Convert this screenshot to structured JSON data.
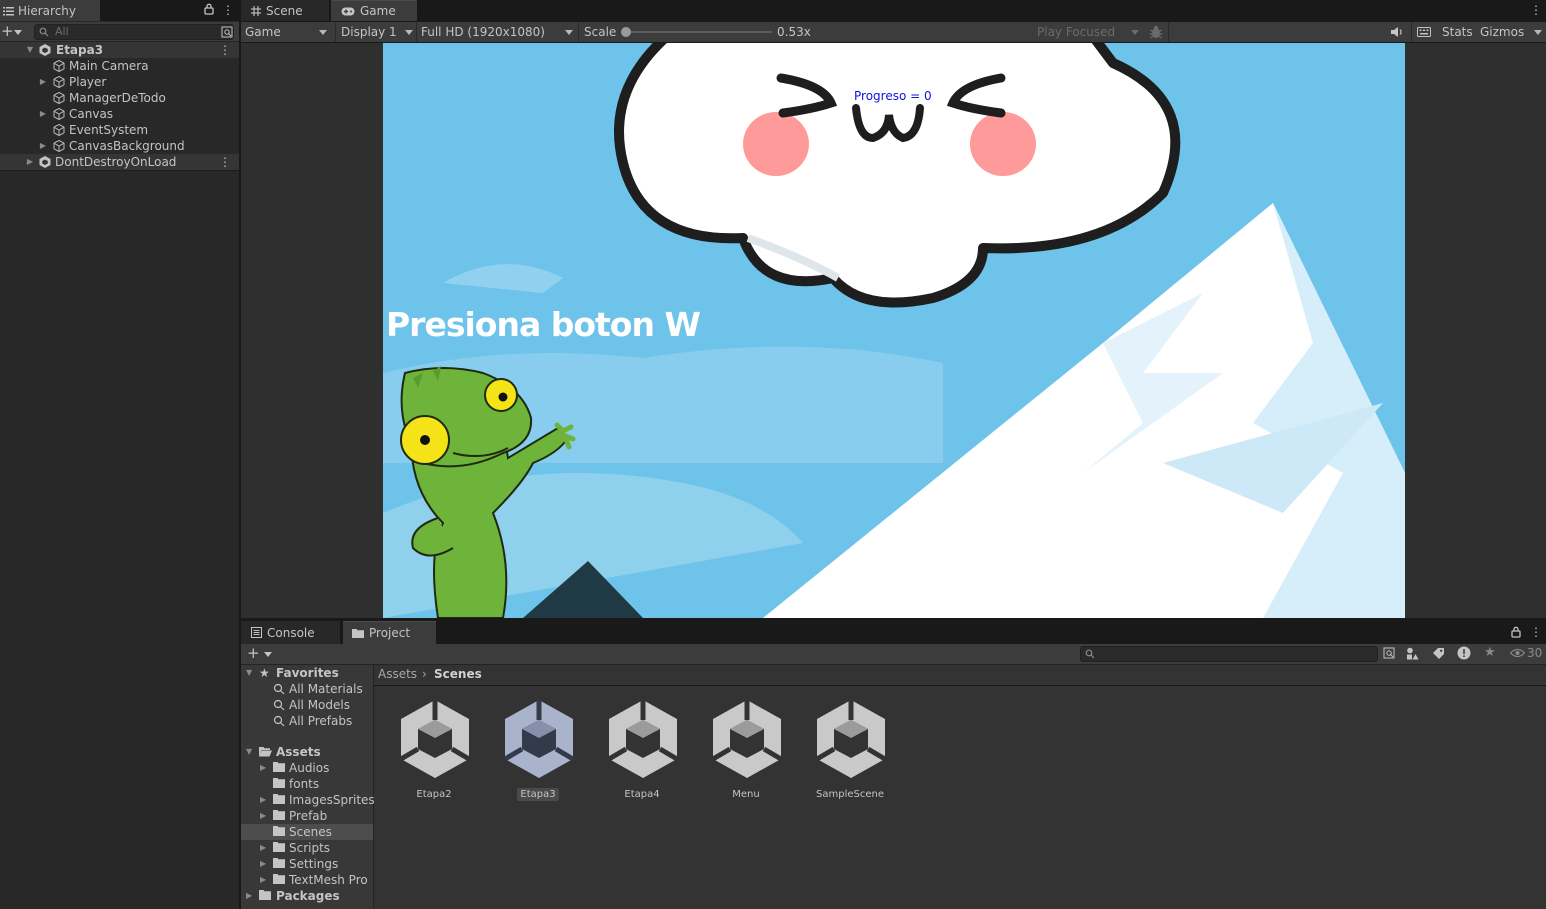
{
  "hierarchy": {
    "tab_label": "Hierarchy",
    "search_placeholder": "All",
    "scene": "Etapa3",
    "items": [
      {
        "label": "Main Camera",
        "expandable": false
      },
      {
        "label": "Player",
        "expandable": true
      },
      {
        "label": "ManagerDeTodo",
        "expandable": false
      },
      {
        "label": "Canvas",
        "expandable": true
      },
      {
        "label": "EventSystem",
        "expandable": false
      },
      {
        "label": "CanvasBackground",
        "expandable": true
      }
    ],
    "dont_destroy": "DontDestroyOnLoad"
  },
  "game_view": {
    "tabs": {
      "scene": "Scene",
      "game": "Game"
    },
    "toolbar": {
      "mode": "Game",
      "display": "Display 1",
      "resolution": "Full HD (1920x1080)",
      "scale_label": "Scale",
      "scale_value": "0.53x",
      "scale_fraction": 0.0,
      "play_focused": "Play Focused",
      "stats": "Stats",
      "gizmos": "Gizmos"
    },
    "scene_content": {
      "progress_text": "Progreso = 0",
      "instruction_text": "Presiona boton W",
      "cloud_face": "w"
    }
  },
  "bottom_panel": {
    "tabs": {
      "console": "Console",
      "project": "Project"
    },
    "visible_count": "30",
    "tree": {
      "favorites_label": "Favorites",
      "favorites": [
        "All Materials",
        "All Models",
        "All Prefabs"
      ],
      "assets_label": "Assets",
      "folders": [
        {
          "label": "Audios",
          "expandable": true
        },
        {
          "label": "fonts",
          "expandable": false
        },
        {
          "label": "ImagesSprites",
          "expandable": true
        },
        {
          "label": "Prefab",
          "expandable": true
        },
        {
          "label": "Scenes",
          "expandable": false,
          "selected": true
        },
        {
          "label": "Scripts",
          "expandable": true
        },
        {
          "label": "Settings",
          "expandable": true
        },
        {
          "label": "TextMesh Pro",
          "expandable": true
        }
      ],
      "packages_label": "Packages"
    },
    "breadcrumb": {
      "root": "Assets",
      "current": "Scenes"
    },
    "assets": [
      {
        "label": "Etapa2",
        "selected": false
      },
      {
        "label": "Etapa3",
        "selected": true
      },
      {
        "label": "Etapa4",
        "selected": false
      },
      {
        "label": "Menu",
        "selected": false
      },
      {
        "label": "SampleScene",
        "selected": false
      }
    ]
  },
  "colors": {
    "editor_bg": "#282828",
    "toolbar_bg": "#3c3c3c",
    "sky": "#6ec3ea",
    "progress_text": "#1010e0",
    "lizard_green": "#6fb43a",
    "cheek_pink": "#ff9a9a"
  }
}
